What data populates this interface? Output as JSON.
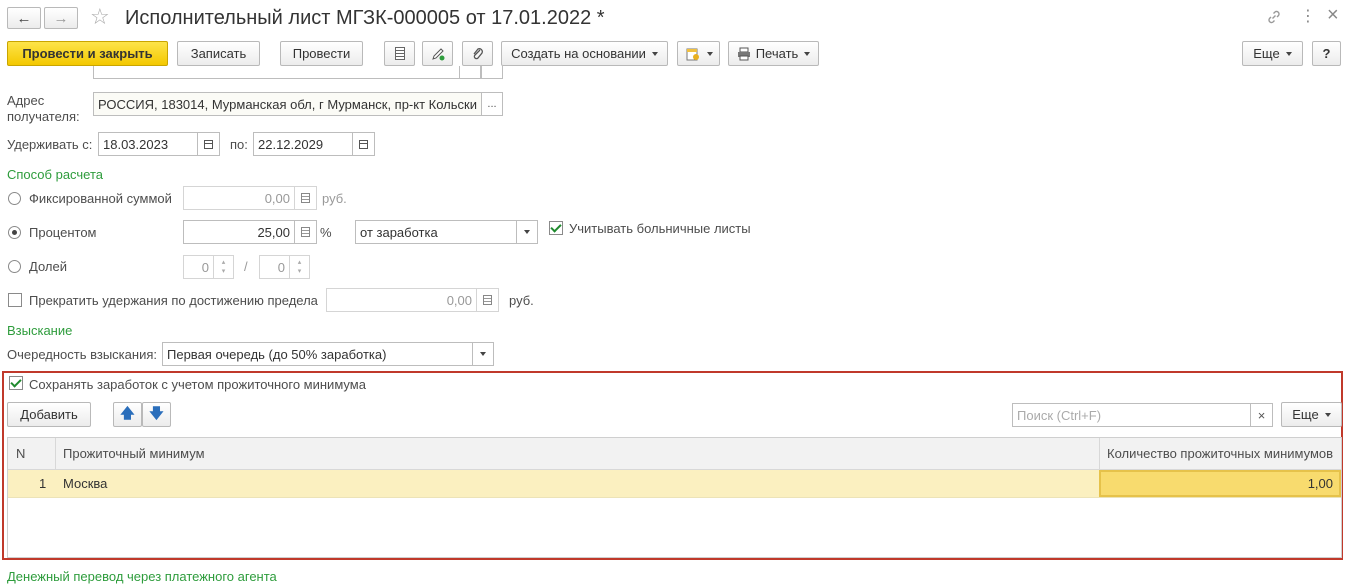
{
  "window": {
    "title": "Исполнительный лист МГЗК-000005 от 17.01.2022 *",
    "nav_back": "←",
    "nav_forward": "→",
    "star": "☆",
    "more": "⋮",
    "close": "×"
  },
  "toolbar": {
    "post_close": "Провести и закрыть",
    "save": "Записать",
    "post": "Провести",
    "create_basis": "Создать на основании",
    "print": "Печать",
    "more": "Еще",
    "help": "?"
  },
  "recipient_address": {
    "label_line1": "Адрес",
    "label_line2": "получателя:",
    "value": "РОССИЯ, 183014, Мурманская обл, г Мурманск, пр-кт Кольски",
    "select_btn": "..."
  },
  "period": {
    "from_label": "Удерживать с:",
    "from_value": "18.03.2023",
    "to_label": "по:",
    "to_value": "22.12.2029"
  },
  "calc_method": {
    "section_title": "Способ расчета",
    "fixed_label": "Фиксированной суммой",
    "fixed_value": "0,00",
    "fixed_unit": "руб.",
    "percent_label": "Процентом",
    "percent_value": "25,00",
    "percent_unit": "%",
    "percent_base": "от заработка",
    "sick_leave_label": "Учитывать больничные листы",
    "sick_leave_checked": true,
    "shares_label": "Долей",
    "share_numerator": "0",
    "share_separator": "/",
    "share_denominator": "0",
    "selected": "percent",
    "limit_label": "Прекратить удержания по достижению предела",
    "limit_value": "0,00",
    "limit_unit": "руб.",
    "limit_checked": false
  },
  "collection": {
    "section_title": "Взыскание",
    "priority_label": "Очередность взыскания:",
    "priority_value": "Первая очередь (до 50% заработка)"
  },
  "subsistence": {
    "keep_label": "Сохранять заработок с учетом прожиточного минимума",
    "keep_checked": true,
    "add_button": "Добавить",
    "search_placeholder": "Поиск (Ctrl+F)",
    "search_clear": "×",
    "more_button": "Еще",
    "columns": [
      "N",
      "Прожиточный минимум",
      "Количество прожиточных минимумов"
    ],
    "rows": [
      {
        "n": "1",
        "minimum": "Москва",
        "count": "1,00"
      }
    ]
  },
  "footer": {
    "payment_agent": "Денежный перевод через платежного агента"
  },
  "colors": {
    "accent_green": "#2e9c3c",
    "primary_yellow": "#f4c800",
    "highlight_border": "#c0392b",
    "selected_row": "#fbf0c0"
  }
}
